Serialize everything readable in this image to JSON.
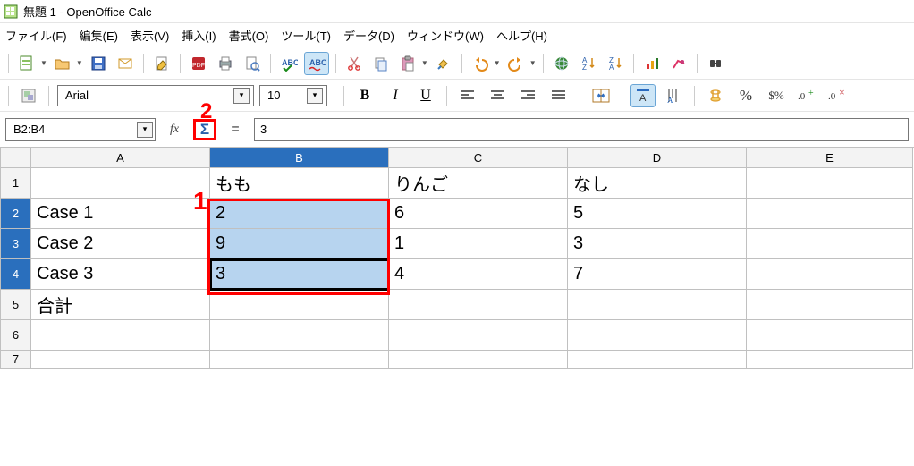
{
  "window": {
    "title": "無題 1 - OpenOffice Calc"
  },
  "menu": {
    "file": "ファイル(F)",
    "edit": "編集(E)",
    "view": "表示(V)",
    "insert": "挿入(I)",
    "format": "書式(O)",
    "tools": "ツール(T)",
    "data": "データ(D)",
    "window": "ウィンドウ(W)",
    "help": "ヘルプ(H)"
  },
  "format_bar": {
    "font_name": "Arial",
    "font_size": "10",
    "bold": "B",
    "italic": "I",
    "underline": "U",
    "percent": "%"
  },
  "formula_bar": {
    "name_box": "B2:B4",
    "fx": "fx",
    "sum": "Σ",
    "eq": "=",
    "input": "3"
  },
  "annotations": {
    "one": "1",
    "two": "2"
  },
  "sheet": {
    "cols": [
      "A",
      "B",
      "C",
      "D",
      "E"
    ],
    "rows": [
      "1",
      "2",
      "3",
      "4",
      "5",
      "6",
      "7"
    ],
    "headers": {
      "b1": "もも",
      "c1": "りんご",
      "d1": "なし"
    },
    "labels": {
      "a2": "Case 1",
      "a3": "Case 2",
      "a4": "Case 3",
      "a5": "合計"
    },
    "values": {
      "b2": "2",
      "c2": "6",
      "d2": "5",
      "b3": "9",
      "c3": "1",
      "d3": "3",
      "b4": "3",
      "c4": "4",
      "d4": "7"
    }
  },
  "chart_data": {
    "type": "table",
    "categories": [
      "もも",
      "りんご",
      "なし"
    ],
    "series": [
      {
        "name": "Case 1",
        "values": [
          2,
          6,
          5
        ]
      },
      {
        "name": "Case 2",
        "values": [
          9,
          1,
          3
        ]
      },
      {
        "name": "Case 3",
        "values": [
          3,
          4,
          7
        ]
      }
    ]
  }
}
